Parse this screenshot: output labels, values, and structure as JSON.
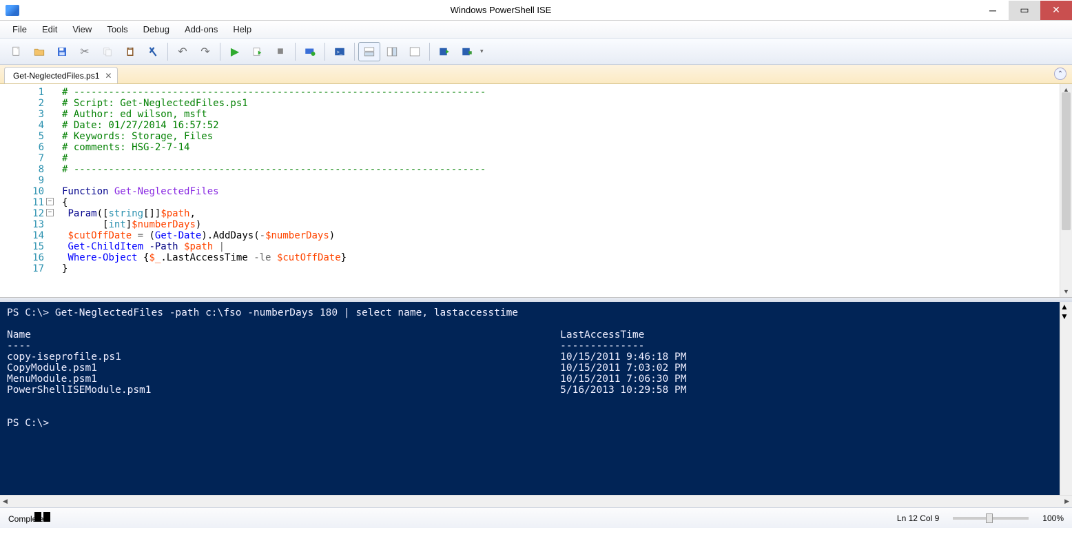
{
  "window": {
    "title": "Windows PowerShell ISE"
  },
  "menu": {
    "items": [
      "File",
      "Edit",
      "View",
      "Tools",
      "Debug",
      "Add-ons",
      "Help"
    ]
  },
  "tab": {
    "name": "Get-NeglectedFiles.ps1"
  },
  "lines": [
    "1",
    "2",
    "3",
    "4",
    "5",
    "6",
    "7",
    "8",
    "9",
    "10",
    "11",
    "12",
    "13",
    "14",
    "15",
    "16",
    "17"
  ],
  "src": {
    "l1": "# -----------------------------------------------------------------------",
    "l2": "# Script: Get-NeglectedFiles.ps1",
    "l3": "# Author: ed wilson, msft",
    "l4": "# Date: 01/27/2014 16:57:52",
    "l5": "# Keywords: Storage, Files",
    "l6": "# comments: HSG-2-7-14",
    "l7": "#",
    "l8": "# -----------------------------------------------------------------------",
    "kw_function": "Function",
    "fn_name": "Get-NeglectedFiles",
    "kw_param": "Param",
    "ty_string": "string",
    "vr_path": "$path",
    "ty_int": "int",
    "vr_numberDays": "$numberDays",
    "vr_cutoff": "$cutOffDate",
    "cm_getdate": "Get-Date",
    "m_adddays": "AddDays",
    "cm_gci": "Get-ChildItem",
    "pr_path": "-Path",
    "cm_where": "Where-Object",
    "vr_pipe": "$_",
    "m_lat": "LastAccessTime",
    "op_le": "-le"
  },
  "console": {
    "prompt1": "PS C:\\> ",
    "cmd": "Get-NeglectedFiles -path c:\\fso -numberDays 180 | select name, lastaccesstime",
    "hdr_name": "Name",
    "hdr_lat": "LastAccessTime",
    "dash_name": "----",
    "dash_lat": "--------------",
    "rows": [
      {
        "n": "copy-iseprofile.ps1",
        "t": "10/15/2011 9:46:18 PM"
      },
      {
        "n": "CopyModule.psm1",
        "t": "10/15/2011 7:03:02 PM"
      },
      {
        "n": "MenuModule.psm1",
        "t": "10/15/2011 7:06:30 PM"
      },
      {
        "n": "PowerShellISEModule.psm1",
        "t": "5/16/2013 10:29:58 PM"
      }
    ],
    "prompt2": "PS C:\\>"
  },
  "status": {
    "state": "Completed",
    "pos": "Ln 12  Col 9",
    "zoom": "100%"
  }
}
